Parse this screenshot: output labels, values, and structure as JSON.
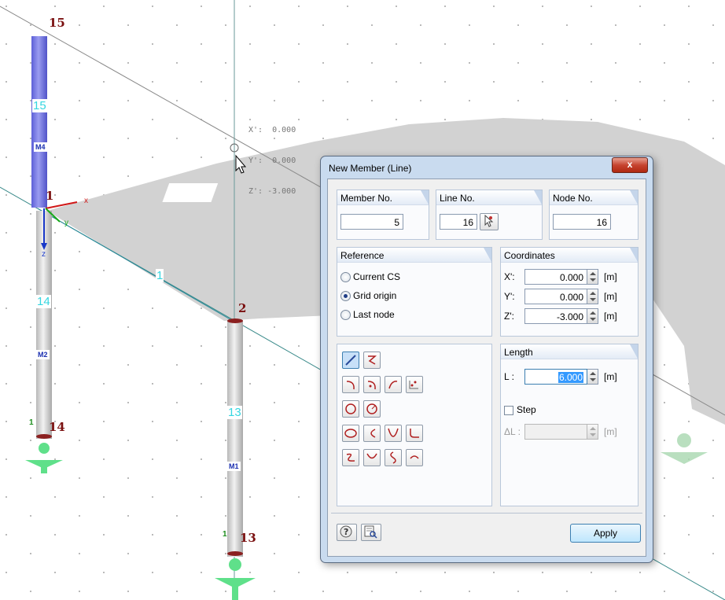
{
  "viewport": {
    "node_labels": [
      "15",
      "1",
      "2",
      "14",
      "13"
    ],
    "line_labels": [
      "15",
      "14",
      "1",
      "13"
    ],
    "member_tags": [
      "M4",
      "M2",
      "M1"
    ],
    "support_counts": [
      "1",
      "1"
    ],
    "axis_labels": {
      "x": "x",
      "y": "y",
      "z": "z"
    },
    "coord_readout": {
      "x_label": "X':",
      "x_value": "0.000",
      "y_label": "Y':",
      "y_value": "0.000",
      "z_label": "Z':",
      "z_value": "-3.000"
    }
  },
  "dialog": {
    "title": "New Member (Line)",
    "close_symbol": "x",
    "member_no": {
      "label": "Member No.",
      "value": "5"
    },
    "line_no": {
      "label": "Line No.",
      "value": "16"
    },
    "node_no": {
      "label": "Node No.",
      "value": "16"
    },
    "reference": {
      "label": "Reference",
      "options": [
        "Current CS",
        "Grid origin",
        "Last node"
      ],
      "selected": "Grid origin"
    },
    "coordinates": {
      "label": "Coordinates",
      "unit": "[m]",
      "rows": [
        {
          "label": "X':",
          "value": "0.000"
        },
        {
          "label": "Y':",
          "value": "0.000"
        },
        {
          "label": "Z':",
          "value": "-3.000"
        }
      ]
    },
    "length": {
      "label": "Length",
      "l_label": "L :",
      "l_value": "6.000",
      "unit": "[m]",
      "step_label": "Step",
      "step_checked": false,
      "delta_label": "ΔL :",
      "delta_value": "",
      "delta_unit": "[m]"
    },
    "tools": [
      "line-tool",
      "polyline-tool",
      "arc-tool",
      "arc-center-tool",
      "arc-tangent-tool",
      "spline-tool",
      "circle-tool",
      "circle-radius-tool",
      "ellipse-tool",
      "elliptical-arc-tool",
      "parabola-tool",
      "fillet-tool",
      "nurbs-tool",
      "hyperbola-tool",
      "sine-tool",
      "offset-tool"
    ],
    "apply_label": "Apply"
  }
}
